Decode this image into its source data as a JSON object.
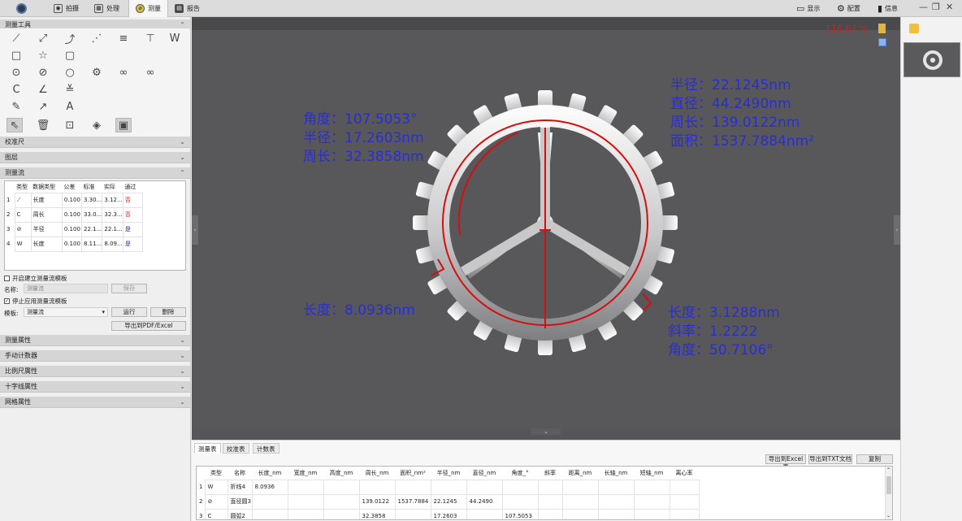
{
  "topbar": {
    "tabs": [
      {
        "label": "拍摄",
        "icon": "camera-icon"
      },
      {
        "label": "处理",
        "icon": "process-icon"
      },
      {
        "label": "测量",
        "icon": "measure-icon"
      },
      {
        "label": "报告",
        "icon": "report-icon"
      }
    ],
    "right": {
      "display": "显示",
      "config": "配置",
      "info": "信息"
    },
    "window_controls": {
      "minimize": "—",
      "restore": "❐",
      "close": "✕"
    }
  },
  "left": {
    "sections": {
      "measure_tools": "测量工具",
      "calibration": "校准尺",
      "layers": "图层",
      "measure_flow": "测量流",
      "measure_props": "测量属性",
      "manual_counter": "手动计数器",
      "scale_props": "比例尺属性",
      "crosshair_props": "十字线属性",
      "grid_props": "网格属性"
    },
    "flow_table": {
      "headers": [
        "类型",
        "数据类型",
        "公差",
        "标准",
        "实际",
        "通过"
      ],
      "rows": [
        {
          "idx": "1",
          "icon": "⟋",
          "type": "长度",
          "tol": "0.100",
          "std": "3.30...",
          "act": "3.12...",
          "pass": "否",
          "pass_color": "red"
        },
        {
          "idx": "2",
          "icon": "C",
          "type": "周长",
          "tol": "0.100",
          "std": "33.0...",
          "act": "32.3...",
          "pass": "否",
          "pass_color": "red"
        },
        {
          "idx": "3",
          "icon": "⊘",
          "type": "半径",
          "tol": "0.100",
          "std": "22.1...",
          "act": "22.1...",
          "pass": "是",
          "pass_color": "blue"
        },
        {
          "idx": "4",
          "icon": "W",
          "type": "长度",
          "tol": "0.100",
          "std": "8.11...",
          "act": "8.09...",
          "pass": "是",
          "pass_color": "blue"
        }
      ]
    },
    "create_template_label": "开启建立测量流模板",
    "name_label": "名称:",
    "name_placeholder": "测量流",
    "save_label": "保存",
    "stop_apply_label": "停止应用测量流模板",
    "template_label": "模板:",
    "template_value": "测量流",
    "run_label": "运行",
    "delete_label": "删除",
    "export_label": "导出到PDF/Excel"
  },
  "viewer": {
    "zoom": "116.67 %",
    "annotations": {
      "top_left": [
        "角度：107.5053°",
        "半径：17.2603nm",
        "周长：32.3858nm"
      ],
      "top_right": [
        "半径：22.1245nm",
        "直径：44.2490nm",
        "周长：139.0122nm",
        "面积：1537.7884nm²"
      ],
      "mid_left": [
        "长度：8.0936nm"
      ],
      "bottom_right": [
        "长度：3.1288nm",
        "斜率：1.2222",
        "角度：50.7106°"
      ]
    },
    "left_handle": "‹",
    "right_handle": "›",
    "bottom_handle": "⌄"
  },
  "bottom": {
    "tabs": [
      "测量表",
      "校准表",
      "计数表"
    ],
    "buttons": {
      "export_excel": "导出到Excel表",
      "export_txt": "导出到TXT文档",
      "copy": "复制"
    },
    "headers": [
      "类型",
      "名称",
      "长度_nm",
      "宽度_nm",
      "高度_nm",
      "周长_nm",
      "面积_nm²",
      "半径_nm",
      "直径_nm",
      "角度_°",
      "斜率",
      "距离_nm",
      "长轴_nm",
      "短轴_nm",
      "离心率"
    ],
    "rows": [
      {
        "idx": "1",
        "icon": "W",
        "cells": [
          "折线4",
          "8.0936",
          "",
          "",
          "",
          "",
          "",
          "",
          "",
          "",
          "",
          "",
          "",
          ""
        ]
      },
      {
        "idx": "2",
        "icon": "⊘",
        "cells": [
          "直径圆3",
          "",
          "",
          "",
          "139.0122",
          "1537.7884",
          "22.1245",
          "44.2490",
          "",
          "",
          "",
          "",
          "",
          ""
        ]
      },
      {
        "idx": "3",
        "icon": "C",
        "cells": [
          "圆弧2",
          "",
          "",
          "",
          "32.3858",
          "",
          "17.2603",
          "",
          "107.5053",
          "",
          "",
          "",
          "",
          ""
        ]
      }
    ]
  }
}
